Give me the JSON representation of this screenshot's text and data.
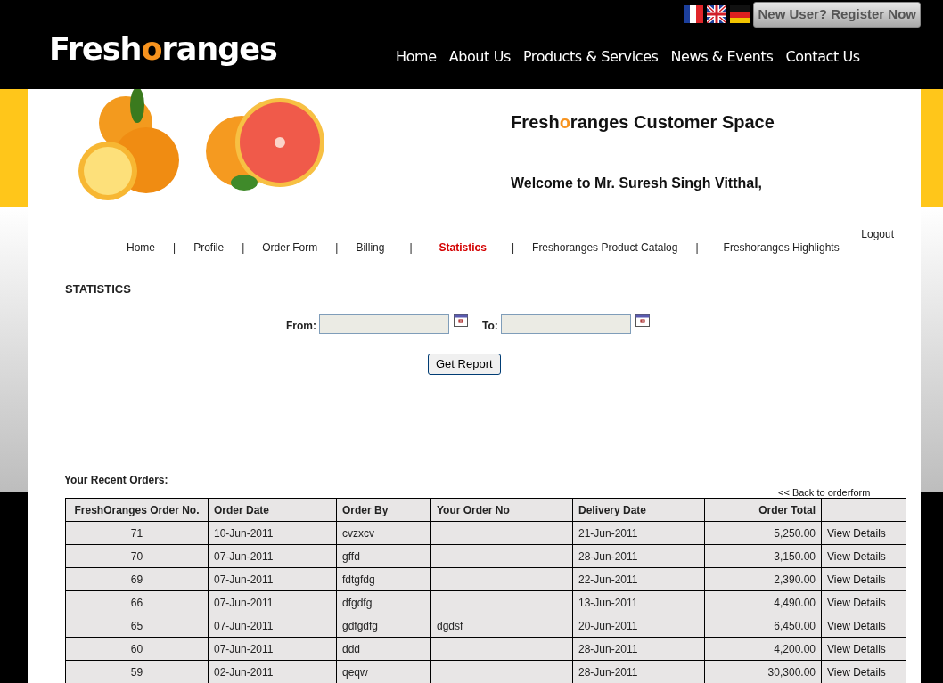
{
  "header": {
    "logo": {
      "before": "Fresh",
      "accent": "o",
      "after": "ranges"
    },
    "register_button": "New User? Register Now",
    "flags": [
      {
        "kind": "fr"
      },
      {
        "kind": "uk"
      },
      {
        "kind": "de"
      }
    ],
    "nav": [
      "Home",
      "About Us",
      "Products & Services",
      "News & Events",
      "Contact Us"
    ]
  },
  "banner": {
    "title": {
      "before": "Fresh",
      "accent": "o",
      "after": "ranges Customer Space"
    },
    "welcome": "Welcome to Mr. Suresh Singh Vitthal,"
  },
  "subnav": {
    "logout": "Logout",
    "items": [
      {
        "label": "Home",
        "selected": false,
        "separator": "|"
      },
      {
        "label": "Profile",
        "selected": false,
        "separator": "|"
      },
      {
        "label": "Order Form",
        "selected": false,
        "separator": "|"
      },
      {
        "label": "Billing",
        "selected": false,
        "separator": "|"
      },
      {
        "label": "Statistics",
        "selected": true,
        "separator": "|"
      },
      {
        "label": "Freshoranges Product Catalog",
        "selected": false,
        "separator": "|"
      },
      {
        "label": "Freshoranges Highlights",
        "selected": false
      }
    ]
  },
  "statistics": {
    "heading": "STATISTICS",
    "from_label": "From:",
    "to_label": "To:",
    "button": "Get Report"
  },
  "orders": {
    "heading": "Your Recent Orders:",
    "back_link": "<< Back to orderform",
    "columns": [
      "FreshOranges Order No.",
      "Order Date",
      "Order By",
      "Your Order No",
      "Delivery Date",
      "Order Total"
    ],
    "rows": [
      [
        "71",
        "10-Jun-2011",
        "cvzxcv",
        "",
        "21-Jun-2011",
        "5,250.00",
        "View Details"
      ],
      [
        "70",
        "07-Jun-2011",
        "gffd",
        "",
        "28-Jun-2011",
        "3,150.00",
        "View Details"
      ],
      [
        "69",
        "07-Jun-2011",
        "fdtgfdg",
        "",
        "22-Jun-2011",
        "2,390.00",
        "View Details"
      ],
      [
        "66",
        "07-Jun-2011",
        "dfgdfg",
        "",
        "13-Jun-2011",
        "4,490.00",
        "View Details"
      ],
      [
        "65",
        "07-Jun-2011",
        "gdfgdfg",
        "dgdsf",
        "20-Jun-2011",
        "6,450.00",
        "View Details"
      ],
      [
        "60",
        "07-Jun-2011",
        "ddd",
        "",
        "28-Jun-2011",
        "4,200.00",
        "View Details"
      ],
      [
        "59",
        "02-Jun-2011",
        "qeqw",
        "",
        "28-Jun-2011",
        "30,300.00",
        "View Details"
      ]
    ]
  }
}
